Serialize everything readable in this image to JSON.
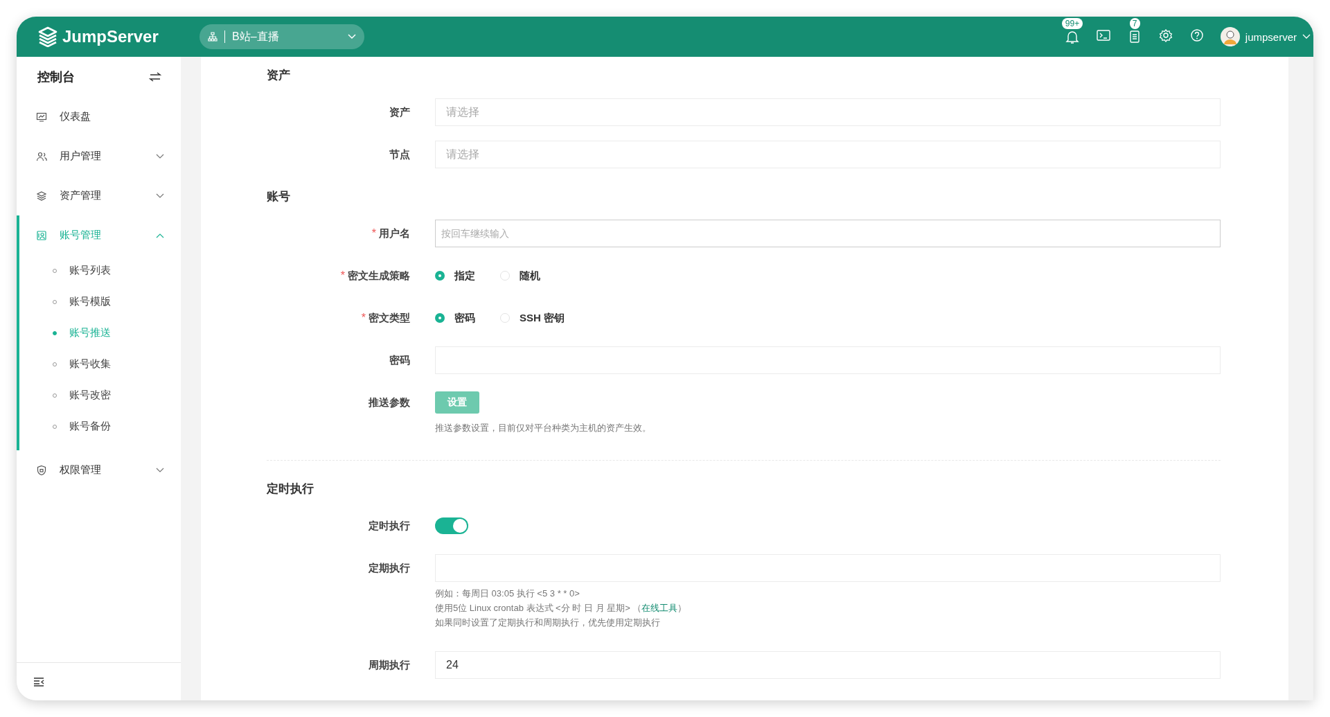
{
  "header": {
    "logo_text": "JumpServer",
    "org_selector": "B站–直播",
    "notifications_badge": "99+",
    "tasks_badge": "7",
    "user": "jumpserver"
  },
  "sidebar": {
    "title": "控制台",
    "items": [
      {
        "kind": "dashboard",
        "label": "仪表盘",
        "selected": false
      },
      {
        "kind": "users",
        "label": "用户管理",
        "expanded": false,
        "selected": false
      },
      {
        "kind": "assets",
        "label": "资产管理",
        "expanded": false,
        "selected": false
      },
      {
        "kind": "accounts",
        "label": "账号管理",
        "expanded": true,
        "selected": true,
        "children": [
          {
            "label": "账号列表",
            "selected": false
          },
          {
            "label": "账号模版",
            "selected": false
          },
          {
            "label": "账号推送",
            "selected": true
          },
          {
            "label": "账号收集",
            "selected": false
          },
          {
            "label": "账号改密",
            "selected": false
          },
          {
            "label": "账号备份",
            "selected": false
          }
        ]
      },
      {
        "kind": "perms",
        "label": "权限管理",
        "expanded": false,
        "selected": false
      }
    ]
  },
  "form": {
    "sections": [
      {
        "title": "资产",
        "fields": [
          {
            "kind": "select",
            "label": "资产",
            "placeholder": "请选择"
          },
          {
            "kind": "select",
            "label": "节点",
            "placeholder": "请选择"
          }
        ]
      },
      {
        "title": "账号",
        "fields": [
          {
            "kind": "tags",
            "label": "用户名",
            "placeholder": "按回车继续输入",
            "required_mark": "*"
          },
          {
            "kind": "radio",
            "label": "密文生成策略",
            "required_mark": "*",
            "options": [
              {
                "label": "指定",
                "selected": true
              },
              {
                "label": "随机",
                "selected": false
              }
            ]
          },
          {
            "kind": "radio",
            "label": "密文类型",
            "required_mark": "*",
            "options": [
              {
                "label": "密码",
                "selected": true
              },
              {
                "label": "SSH 密钥",
                "selected": false
              }
            ]
          },
          {
            "kind": "text",
            "label": "密码"
          },
          {
            "kind": "button",
            "label": "推送参数",
            "button": "设置",
            "help": [
              "推送参数设置，目前仅对平台种类为主机的资产生效。"
            ]
          }
        ]
      },
      {
        "title": "定时执行",
        "fields": [
          {
            "kind": "switch",
            "label": "定时执行",
            "on": true
          },
          {
            "kind": "text",
            "label": "定期执行",
            "help": [
              "例如：每周日 03:05 执行 <5 3 * * 0>",
              {
                "before": "使用5位 Linux crontab 表达式 <分 时 日 月 星期> （",
                "link": "在线工具",
                "after": "）"
              },
              "如果同时设置了定期执行和周期执行，优先使用定期执行"
            ]
          },
          {
            "kind": "text",
            "label": "周期执行",
            "value": "24"
          }
        ]
      }
    ]
  }
}
